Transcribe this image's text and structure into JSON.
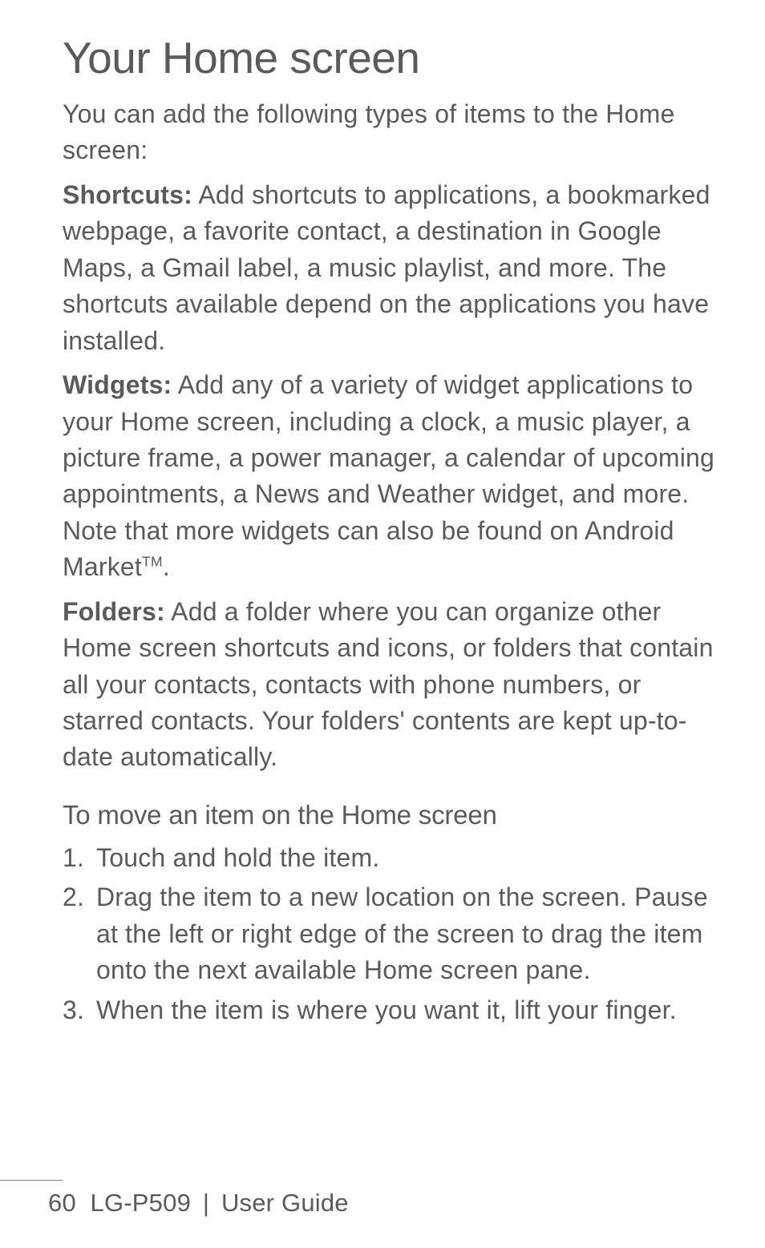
{
  "title": "Your Home screen",
  "intro": "You can add the following types of items to the Home screen:",
  "items": {
    "shortcuts": {
      "label": "Shortcuts:",
      "text": " Add shortcuts to applications, a bookmarked webpage, a favorite contact, a destination in Google Maps, a Gmail label, a music playlist, and more. The shortcuts available depend on the applications you have installed."
    },
    "widgets": {
      "label": "Widgets:",
      "text_before": " Add any of a variety of widget applications to your Home screen, including a clock, a music player, a picture frame, a power manager, a calendar of upcoming appointments, a News and Weather widget, and more. Note that more widgets can also be found on Android Market",
      "tm": "TM",
      "text_after": "."
    },
    "folders": {
      "label": "Folders:",
      "text": " Add a folder where you can organize other Home screen shortcuts and icons, or folders that contain all your contacts, contacts with phone numbers, or starred contacts. Your folders' contents are kept up-to-date automatically."
    }
  },
  "section": {
    "heading": "To move an item on the Home screen",
    "steps": [
      {
        "num": "1.",
        "text": " Touch and hold the item."
      },
      {
        "num": "2.",
        "text": "Drag the item to a new location on the screen. Pause at the left or right edge of the screen to drag the item onto the next available Home screen pane."
      },
      {
        "num": "3.",
        "text": "When the item is where you want it, lift your finger."
      }
    ]
  },
  "footer": {
    "page": "60",
    "model": "LG-P509",
    "sep": "|",
    "doc": "User Guide"
  }
}
